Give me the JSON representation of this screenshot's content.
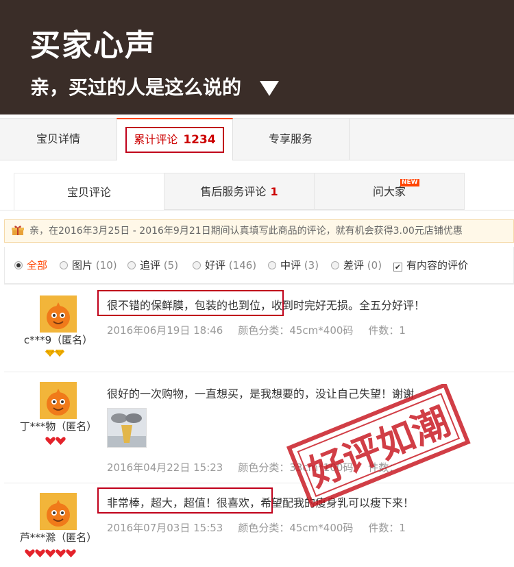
{
  "header": {
    "title": "买家心声",
    "subtitle": "亲，买过的人是这么说的"
  },
  "main_tabs": {
    "details": "宝贝详情",
    "reviews_label": "累计评论",
    "reviews_count": "1234",
    "service": "专享服务"
  },
  "sub_tabs": {
    "item_reviews": "宝贝评论",
    "after_sale_label": "售后服务评论",
    "after_sale_count": "1",
    "ask": "问大家",
    "new_badge": "NEW"
  },
  "notice": "亲，在2016年3月25日 - 2016年9月21日期间认真填写此商品的评论，就有机会获得3.00元店铺优惠",
  "filters": {
    "all": "全部",
    "images_label": "图片",
    "images_count": "(10)",
    "followup_label": "追评",
    "followup_count": "(5)",
    "good_label": "好评",
    "good_count": "(146)",
    "medium_label": "中评",
    "medium_count": "(3)",
    "bad_label": "差评",
    "bad_count": "(0)",
    "content_only": "有内容的评价"
  },
  "reviews": [
    {
      "user": "c***9（匿名）",
      "text_highlight": "很不错的保鲜膜，包装的也到位，",
      "text_rest": "收到时完好无损。全五分好评！",
      "date": "2016年06月19日 18:46",
      "sku": "颜色分类：45cm*400码",
      "qty": "件数：1"
    },
    {
      "user": "丁***物（匿名）",
      "text": "很好的一次购物，一直想买，是我想要的，没让自己失望！谢谢",
      "date": "2016年04月22日 15:23",
      "sku": "颜色分类：33cm*100码",
      "qty": "件数："
    },
    {
      "user": "芦***滁（匿名）",
      "text_highlight": "非常棒，超大，超值！很喜欢，",
      "text_rest": "希望配我的瘦身乳可以瘦下来！",
      "date": "2016年07月03日 15:53",
      "sku": "颜色分类：45cm*400码",
      "qty": "件数：1"
    }
  ],
  "stamp": "好评如潮",
  "colors": {
    "header_bg": "#3a2d28",
    "accent": "#ff4400",
    "highlight_box": "#c0001a",
    "avatar_bg": "#f2b53a"
  }
}
